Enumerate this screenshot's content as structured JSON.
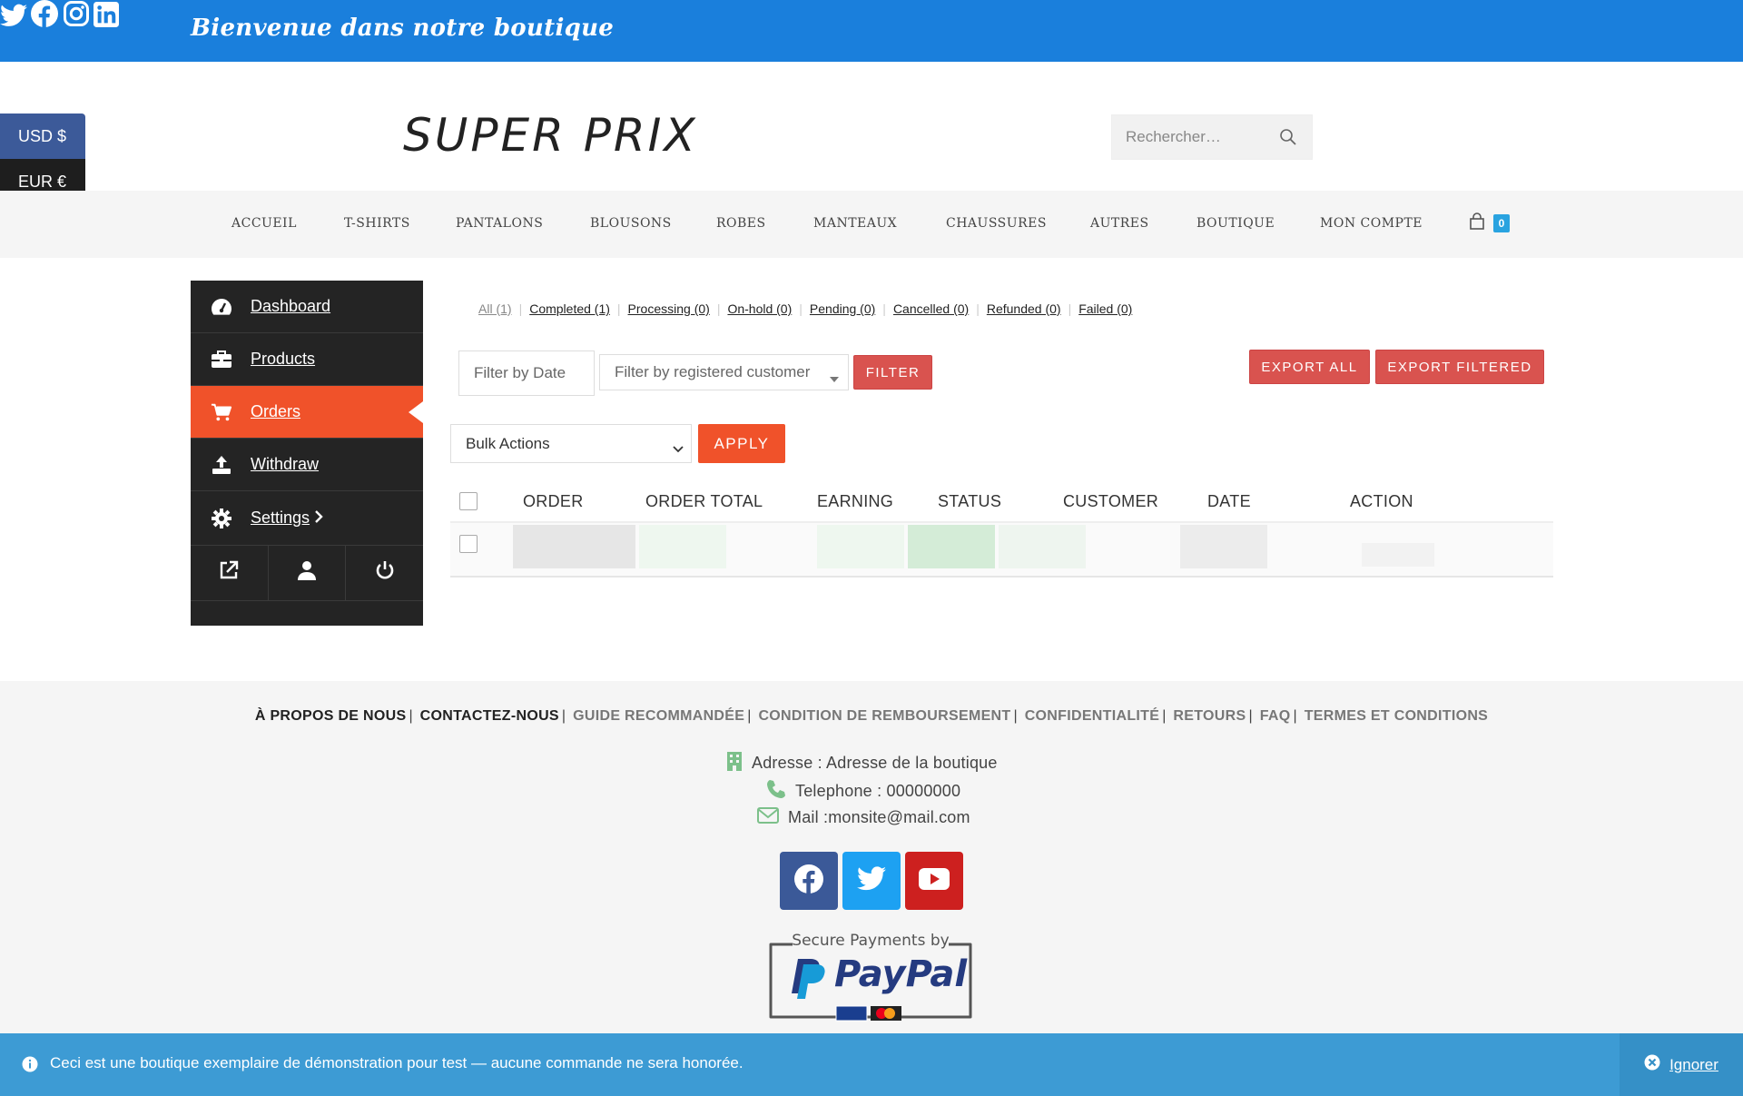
{
  "topbar": {
    "welcome": "Bienvenue dans notre boutique",
    "social_icons": [
      "twitter-icon",
      "facebook-icon",
      "instagram-icon",
      "linkedin-icon"
    ]
  },
  "currency": {
    "usd": "USD $",
    "eur": "EUR €"
  },
  "header": {
    "logo": "SUPER PRIX",
    "search_placeholder": "Rechercher…"
  },
  "nav": {
    "items": [
      "ACCUEIL",
      "T-SHIRTS",
      "PANTALONS",
      "BLOUSONS",
      "ROBES",
      "MANTEAUX",
      "CHAUSSURES",
      "AUTRES",
      "BOUTIQUE",
      "MON COMPTE"
    ],
    "cart_count": "0"
  },
  "sidebar": {
    "items": [
      {
        "label": "Dashboard",
        "icon": "dashboard-gauge-icon"
      },
      {
        "label": "Products",
        "icon": "briefcase-icon"
      },
      {
        "label": "Orders",
        "icon": "cart-icon"
      },
      {
        "label": "Withdraw",
        "icon": "upload-icon"
      },
      {
        "label": "Settings",
        "icon": "gear-icon"
      }
    ],
    "bottom_icons": [
      "external-link-icon",
      "user-icon",
      "power-icon"
    ]
  },
  "orders": {
    "status_links": [
      "All (1)",
      "Completed (1)",
      "Processing (0)",
      "On-hold (0)",
      "Pending (0)",
      "Cancelled (0)",
      "Refunded (0)",
      "Failed (0)"
    ],
    "filter_date_placeholder": "Filter by Date",
    "filter_customer_placeholder": "Filter by registered customer",
    "filter_button": "FILTER",
    "export_all": "EXPORT ALL",
    "export_filtered": "EXPORT FILTERED",
    "bulk_actions": "Bulk Actions",
    "apply": "APPLY",
    "columns": [
      "ORDER",
      "ORDER TOTAL",
      "EARNING",
      "STATUS",
      "CUSTOMER",
      "DATE",
      "ACTION"
    ]
  },
  "footer": {
    "links": [
      "À PROPOS DE NOUS",
      "CONTACTEZ-NOUS",
      "GUIDE RECOMMANDÉE",
      "CONDITION DE REMBOURSEMENT",
      "CONFIDENTIALITÉ",
      "RETOURS",
      "FAQ",
      "TERMES ET CONDITIONS"
    ],
    "address": "Adresse : Adresse de la boutique",
    "phone": "Telephone : 00000000",
    "mail": "Mail :monsite@mail.com",
    "paypal_caption": "Secure Payments by",
    "paypal_brand": "PayPal",
    "colors": {
      "facebook": "#3b5998",
      "twitter": "#1da1f2",
      "youtube": "#cd201f",
      "icon_green": "#7cc08a"
    }
  },
  "notice": {
    "message": "Ceci est une boutique exemplaire de démonstration pour test — aucune commande ne sera honorée.",
    "dismiss": "Ignorer"
  },
  "colors": {
    "topbar": "#1a7fdc",
    "accent_orange": "#f0522a",
    "button_red": "#d9534f",
    "sidebar_bg": "#242424",
    "notice_bg": "#3d9bd4"
  }
}
